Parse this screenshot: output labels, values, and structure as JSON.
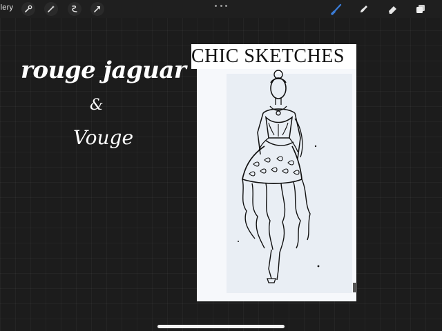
{
  "toolbar": {
    "gallery_label": "llery",
    "left_tools": [
      "wrench-icon",
      "magic-wand-icon",
      "selection-icon",
      "transform-arrow-icon"
    ],
    "right_tools": [
      "brush-icon",
      "smudge-icon",
      "eraser-icon",
      "layers-icon"
    ],
    "active_color": "#3a7bd5"
  },
  "canvas": {
    "brand_line1": "rouge jaguar",
    "brand_amp": "&",
    "brand_line2": "Vouge",
    "header_title": "CHIC SKETCHES"
  },
  "colors": {
    "background": "#1c1c1c",
    "toolbar": "#1f1f1f",
    "text": "#ffffff"
  }
}
